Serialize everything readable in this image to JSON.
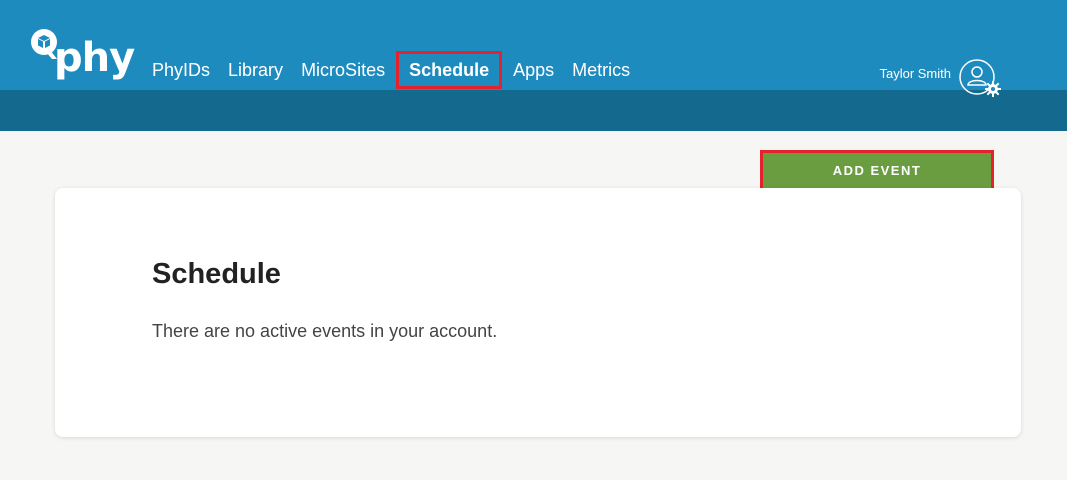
{
  "header": {
    "logo_text": "phy",
    "nav": [
      {
        "label": "PhyIDs"
      },
      {
        "label": "Library"
      },
      {
        "label": "MicroSites"
      },
      {
        "label": "Schedule"
      },
      {
        "label": "Apps"
      },
      {
        "label": "Metrics"
      }
    ],
    "active_nav": "Schedule",
    "user_name": "Taylor Smith"
  },
  "actions": {
    "add_event_label": "ADD EVENT"
  },
  "main": {
    "title": "Schedule",
    "empty_message": "There are no active events in your account."
  },
  "colors": {
    "header": "#1e8bbf",
    "subheader": "#146a8e",
    "button": "#6a9c40",
    "highlight": "#e3222b"
  },
  "icons": [
    "logo-cube-icon",
    "user-avatar-icon",
    "gear-icon"
  ]
}
